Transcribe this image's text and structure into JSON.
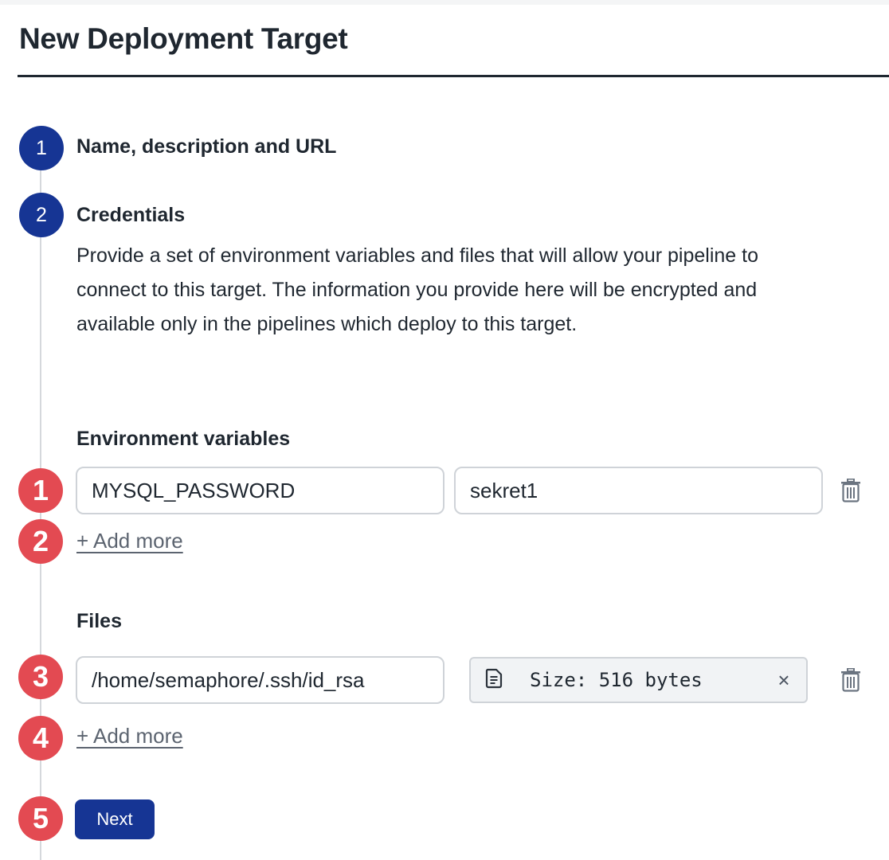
{
  "page": {
    "title": "New Deployment Target"
  },
  "steps": [
    {
      "number": "1",
      "label": "Name, description and URL"
    },
    {
      "number": "2",
      "label": "Credentials",
      "description": "Provide a set of environment variables and files that will allow your pipeline to connect to this target. The information you provide here will be encrypted and available only in the pipelines which deploy to this target."
    }
  ],
  "env_vars": {
    "heading": "Environment variables",
    "rows": [
      {
        "name": "MYSQL_PASSWORD",
        "value": "sekret1"
      }
    ],
    "add_more": "+ Add more"
  },
  "files": {
    "heading": "Files",
    "rows": [
      {
        "path": "/home/semaphore/.ssh/id_rsa",
        "content": "Size: 516 bytes"
      }
    ],
    "add_more": "+ Add more",
    "remove_symbol": "×"
  },
  "actions": {
    "next_label": "Next"
  },
  "callouts": [
    "1",
    "2",
    "3",
    "4",
    "5"
  ],
  "colors": {
    "step_circle": "#163594",
    "callout": "#e34a52",
    "primary_button": "#163594",
    "link": "#5c6470"
  },
  "icons": {
    "delete": "trash-icon",
    "file": "file-document-icon",
    "remove": "close-icon"
  }
}
